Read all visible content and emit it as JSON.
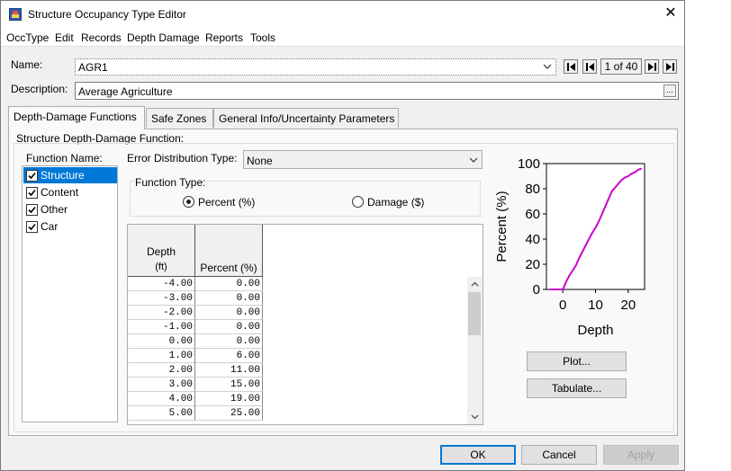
{
  "window": {
    "title": "Structure Occupancy Type Editor",
    "close_glyph": "✕"
  },
  "menu": [
    "OccType",
    "Edit",
    "Records",
    "Depth Damage",
    "Reports",
    "Tools"
  ],
  "name_field": {
    "label": "Name:",
    "value": "AGR1"
  },
  "record_nav": {
    "position": "1 of 40"
  },
  "description_field": {
    "label": "Description:",
    "value": "Average Agriculture",
    "browse_label": "..."
  },
  "tabs": [
    {
      "label": "Depth-Damage Functions",
      "active": true
    },
    {
      "label": "Safe Zones",
      "active": false
    },
    {
      "label": "General Info/Uncertainty Parameters",
      "active": false
    }
  ],
  "panel": {
    "group_title": "Structure Depth-Damage Function:",
    "function_name_label": "Function Name:",
    "functions": [
      {
        "label": "Structure",
        "checked": true,
        "selected": true
      },
      {
        "label": "Content",
        "checked": true,
        "selected": false
      },
      {
        "label": "Other",
        "checked": true,
        "selected": false
      },
      {
        "label": "Car",
        "checked": true,
        "selected": false
      }
    ],
    "error_dist_label": "Error Distribution Type:",
    "error_dist_value": "None",
    "function_type_label": "Function Type:",
    "function_type_options": [
      {
        "label": "Percent (%)",
        "selected": true
      },
      {
        "label": "Damage ($)",
        "selected": false
      }
    ],
    "table": {
      "headers": [
        {
          "line1": "Depth",
          "line2": "(ft)"
        },
        {
          "line1": "",
          "line2": "Percent (%)"
        }
      ],
      "rows": [
        [
          "-4.00",
          "0.00"
        ],
        [
          "-3.00",
          "0.00"
        ],
        [
          "-2.00",
          "0.00"
        ],
        [
          "-1.00",
          "0.00"
        ],
        [
          "0.00",
          "0.00"
        ],
        [
          "1.00",
          "6.00"
        ],
        [
          "2.00",
          "11.00"
        ],
        [
          "3.00",
          "15.00"
        ],
        [
          "4.00",
          "19.00"
        ],
        [
          "5.00",
          "25.00"
        ]
      ]
    },
    "plot_button": "Plot...",
    "tabulate_button": "Tabulate..."
  },
  "chart_data": {
    "type": "line",
    "xlabel": "Depth",
    "ylabel": "Percent (%)",
    "xlim": [
      -5,
      25
    ],
    "ylim": [
      0,
      100
    ],
    "x_ticks": [
      "0",
      "10",
      "20"
    ],
    "y_ticks": [
      "0",
      "20",
      "40",
      "60",
      "80",
      "100"
    ],
    "line_color": "#cc00cc",
    "series": [
      {
        "x": [
          -4,
          -3,
          -2,
          -1,
          0,
          1,
          2,
          3,
          4,
          5,
          6,
          7,
          8,
          9,
          10,
          11,
          12,
          13,
          14,
          15,
          16,
          17,
          18,
          19,
          20,
          21,
          22,
          23,
          24
        ],
        "y": [
          0,
          0,
          0,
          0,
          0,
          6,
          11,
          15,
          19,
          25,
          30,
          35,
          40,
          45,
          49,
          54,
          60,
          66,
          72,
          78,
          81,
          84,
          87,
          89,
          90,
          92,
          93,
          95,
          96
        ]
      }
    ]
  },
  "buttons": {
    "ok": "OK",
    "cancel": "Cancel",
    "apply": "Apply"
  },
  "colors": {
    "selection": "#0078d7",
    "default_button_border": "#0078d7"
  }
}
